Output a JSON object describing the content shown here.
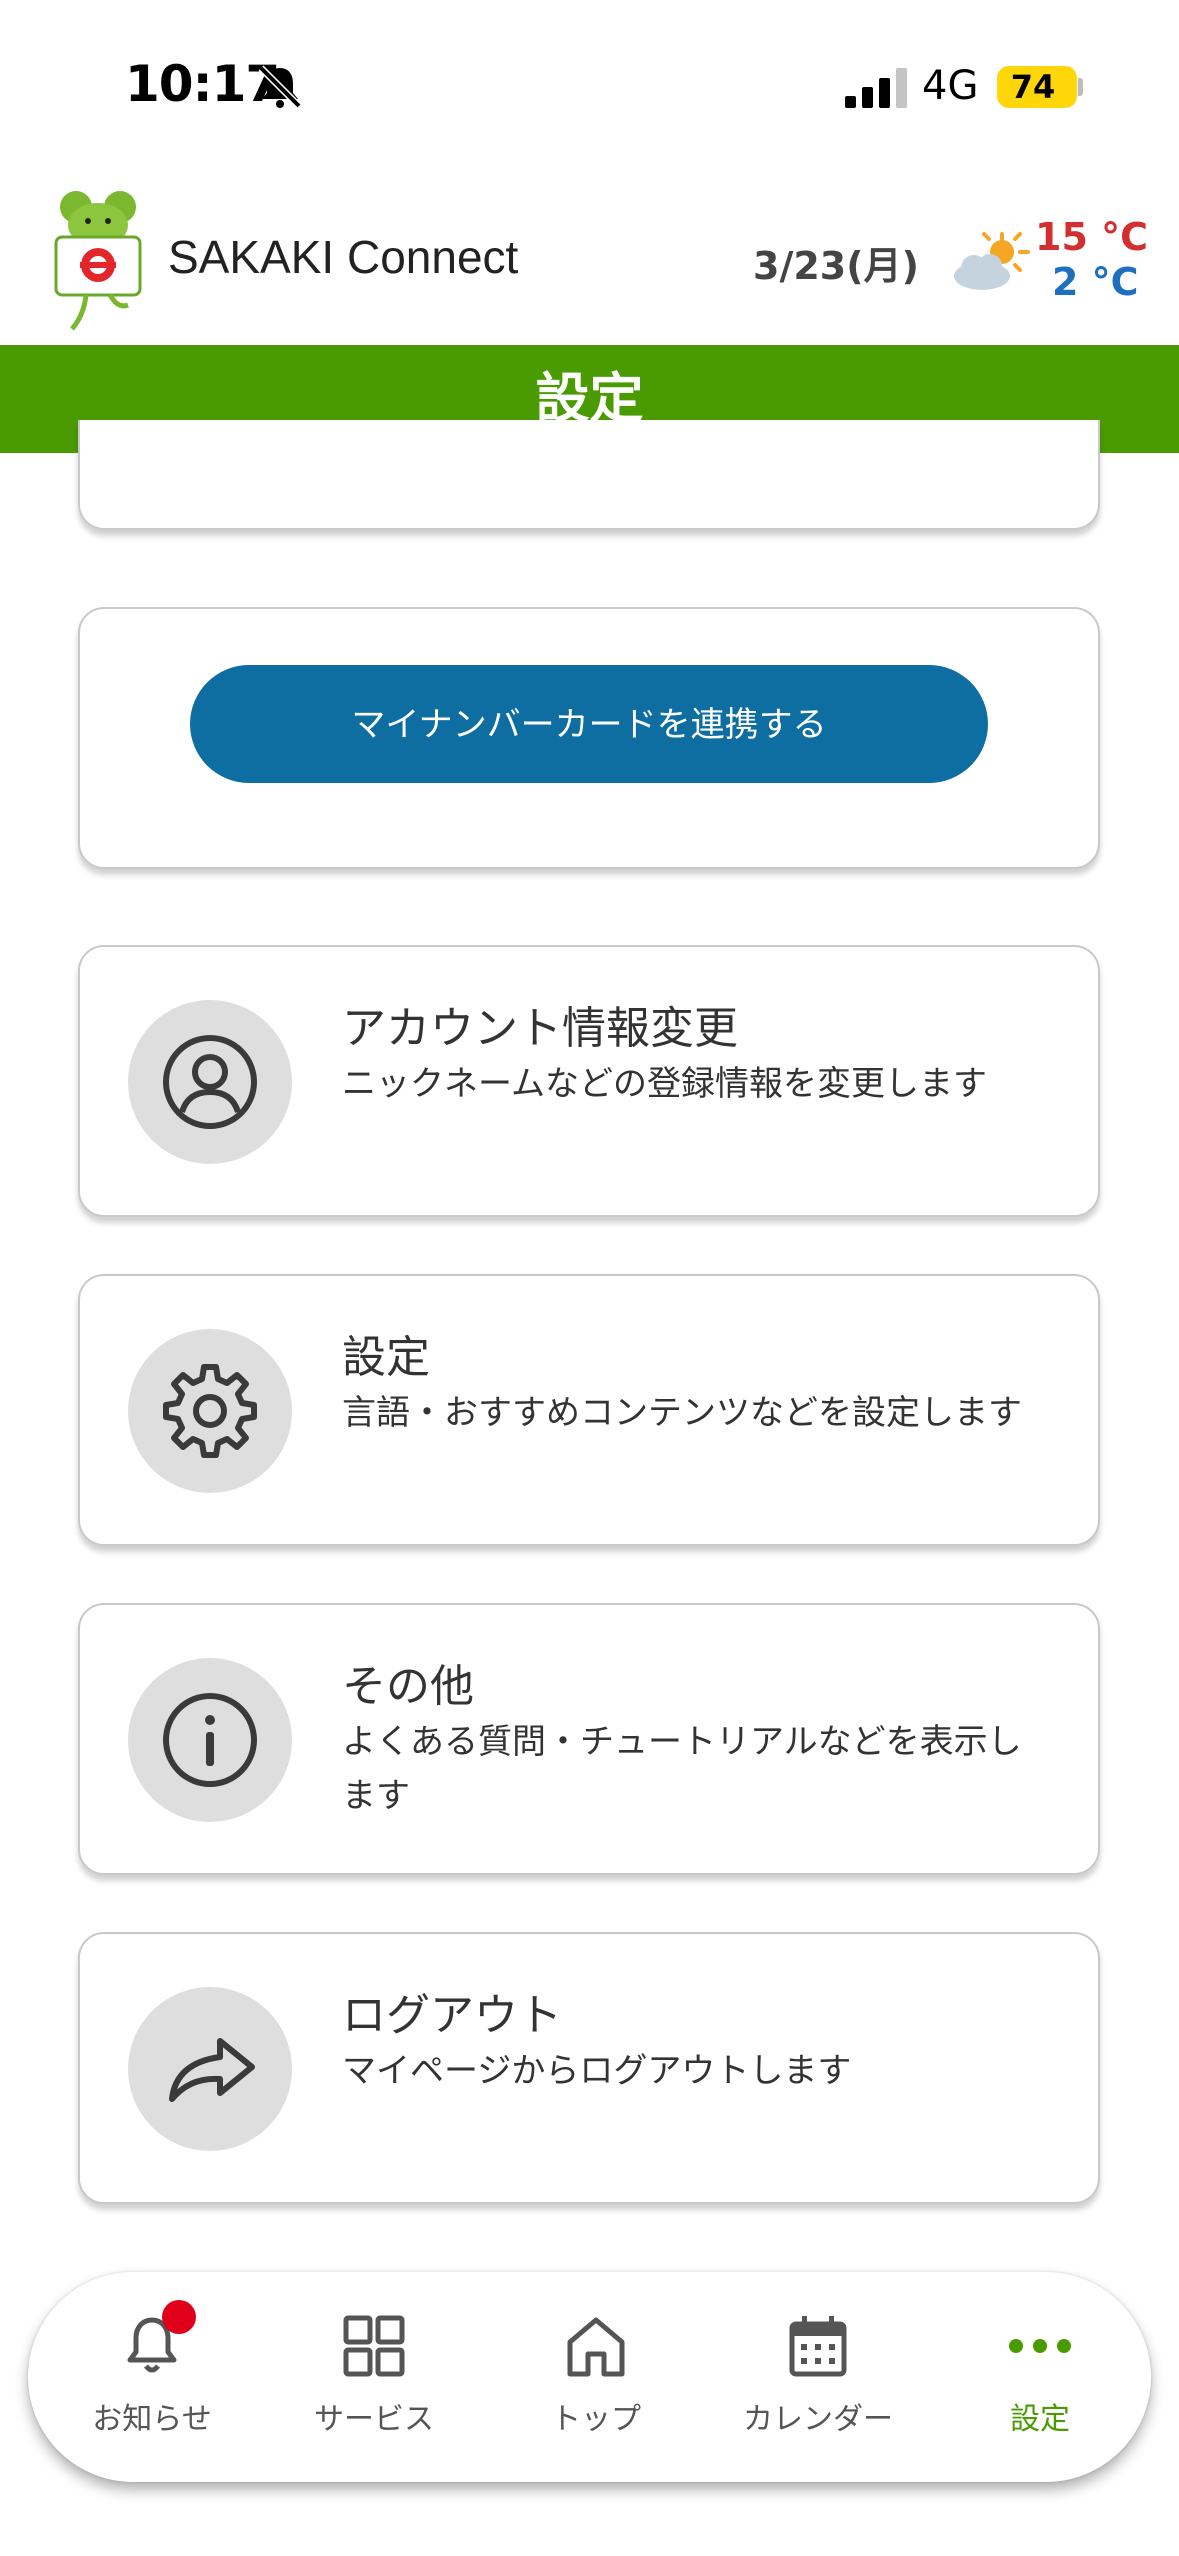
{
  "status_bar": {
    "time": "10:17",
    "network": "4G",
    "battery": "74",
    "icons": [
      "bell-off-icon",
      "signal-icon",
      "battery-icon"
    ]
  },
  "header": {
    "app_title": "SAKAKI Connect",
    "date": "3/23(月)",
    "temp_high": "15 °C",
    "temp_low": "2 °C",
    "weather_icon": "partly-cloudy-icon"
  },
  "page": {
    "title": "設定"
  },
  "mynumber": {
    "button_label": "マイナンバーカードを連携する"
  },
  "menu": [
    {
      "title": "アカウント情報変更",
      "desc": "ニックネームなどの登録情報を変更します",
      "icon": "user-icon"
    },
    {
      "title": "設定",
      "desc": "言語・おすすめコンテンツなどを設定します",
      "icon": "gear-icon"
    },
    {
      "title": "その他",
      "desc": "よくある質問・チュートリアルなどを表示します",
      "icon": "info-icon"
    },
    {
      "title": "ログアウト",
      "desc": "マイページからログアウトします",
      "icon": "share-arrow-icon"
    }
  ],
  "bottom_nav": [
    {
      "label": "お知らせ",
      "icon": "bell-icon"
    },
    {
      "label": "サービス",
      "icon": "grid-icon"
    },
    {
      "label": "トップ",
      "icon": "home-icon"
    },
    {
      "label": "カレンダー",
      "icon": "calendar-icon"
    },
    {
      "label": "設定",
      "icon": "more-icon",
      "active": true
    }
  ],
  "colors": {
    "brand_green": "#4a9b02",
    "button_blue": "#0e6ea1",
    "temp_high": "#d32f2f",
    "temp_low": "#1e6fbf",
    "notification": "#e0001b"
  }
}
